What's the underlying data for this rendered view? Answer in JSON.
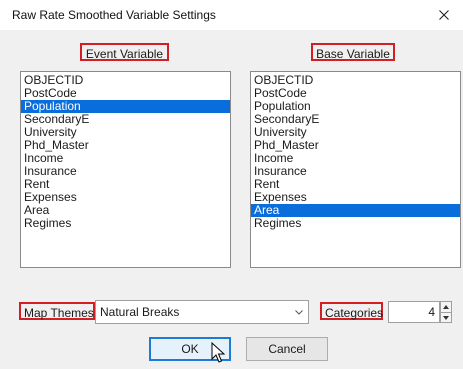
{
  "window": {
    "title": "Raw Rate Smoothed Variable Settings"
  },
  "icons": {
    "close": "close-icon",
    "dropdown": "chevron-down-icon",
    "spin_up": "caret-up-icon",
    "spin_down": "caret-down-icon",
    "cursor": "mouse-pointer-icon"
  },
  "colors": {
    "highlight_border": "#d21f26",
    "selection": "#0a6ddc",
    "default_button": "#1f7ad6"
  },
  "event_variable": {
    "label": "Event Variable",
    "items": [
      "OBJECTID",
      "PostCode",
      "Population",
      "SecondaryE",
      "University",
      "Phd_Master",
      "Income",
      "Insurance",
      "Rent",
      "Expenses",
      "Area",
      "Regimes"
    ],
    "selected": "Population"
  },
  "base_variable": {
    "label": "Base Variable",
    "items": [
      "OBJECTID",
      "PostCode",
      "Population",
      "SecondaryE",
      "University",
      "Phd_Master",
      "Income",
      "Insurance",
      "Rent",
      "Expenses",
      "Area",
      "Regimes"
    ],
    "selected": "Area"
  },
  "map_themes": {
    "label": "Map Themes",
    "value": "Natural Breaks"
  },
  "categories": {
    "label": "Categories",
    "value": "4"
  },
  "buttons": {
    "ok": "OK",
    "cancel": "Cancel"
  }
}
